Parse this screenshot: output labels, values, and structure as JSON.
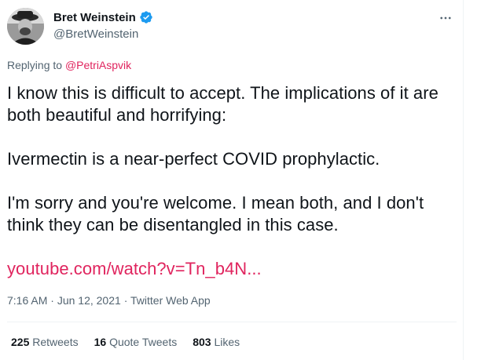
{
  "author": {
    "name": "Bret Weinstein",
    "handle": "@BretWeinstein",
    "verified": true
  },
  "reply": {
    "prefix": "Replying to",
    "mention": "@PetriAspvik"
  },
  "tweet": {
    "paragraphs": [
      "I know this is difficult to accept. The implications of it are both beautiful and horrifying:",
      "Ivermectin is a near-perfect COVID prophylactic.",
      "I'm sorry and you're welcome. I mean both, and I don't think they can be disentangled in this case."
    ],
    "link": "youtube.com/watch?v=Tn_b4N..."
  },
  "meta": {
    "time": "7:16 AM",
    "separator": "·",
    "date": "Jun 12, 2021",
    "source": "Twitter Web App"
  },
  "stats": [
    {
      "value": "225",
      "label": "Retweets"
    },
    {
      "value": "16",
      "label": "Quote Tweets"
    },
    {
      "value": "803",
      "label": "Likes"
    }
  ],
  "colors": {
    "link": "#e0245e",
    "verified": "#1d9bf0",
    "secondary_text": "#536471"
  },
  "icons": {
    "verified": "verified-badge-icon",
    "more": "more-icon"
  }
}
